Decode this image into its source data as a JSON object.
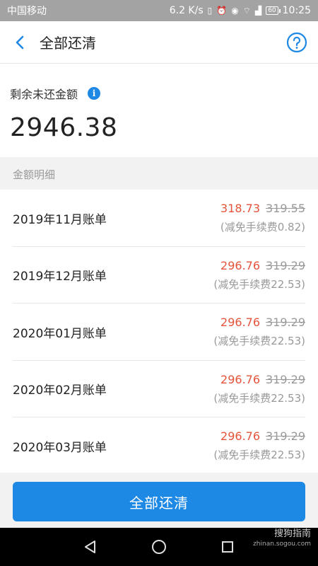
{
  "status_bar": {
    "carrier": "中国移动",
    "speed": "6.2 K/s",
    "battery": "60",
    "time": "10:25"
  },
  "header": {
    "title": "全部还清"
  },
  "summary": {
    "label": "剩余未还金额",
    "amount": "2946.38"
  },
  "details": {
    "section_title": "金额明细",
    "bills": [
      {
        "label": "2019年11月账单",
        "amount": "318.73",
        "original": "319.55",
        "fee_note": "(减免手续费0.82)"
      },
      {
        "label": "2019年12月账单",
        "amount": "296.76",
        "original": "319.29",
        "fee_note": "(减免手续费22.53)"
      },
      {
        "label": "2020年01月账单",
        "amount": "296.76",
        "original": "319.29",
        "fee_note": "(减免手续费22.53)"
      },
      {
        "label": "2020年02月账单",
        "amount": "296.76",
        "original": "319.29",
        "fee_note": "(减免手续费22.53)"
      },
      {
        "label": "2020年03月账单",
        "amount": "296.76",
        "original": "319.29",
        "fee_note": "(减免手续费22.53)"
      }
    ]
  },
  "actions": {
    "pay_all_label": "全部还清"
  },
  "watermark": {
    "line1": "搜狗指南",
    "line2": "zhinan.sogou.com"
  },
  "colors": {
    "accent": "#1e88e5",
    "highlight_red": "#e5533b"
  },
  "icons": {
    "back": "chevron-left-icon",
    "help": "question-circle-icon",
    "info": "info-icon"
  }
}
